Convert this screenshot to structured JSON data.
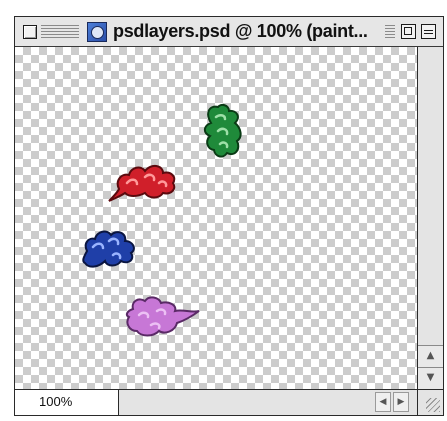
{
  "window": {
    "title": "psdlayers.psd @ 100% (paint...",
    "document_icon": "photoshop-document-icon",
    "controls": [
      "close-box",
      "zoom-box",
      "collapse-box"
    ]
  },
  "canvas": {
    "background": "transparency-checkerboard",
    "layers": [
      {
        "name": "green-paint-splat",
        "color": "#1f8a3a"
      },
      {
        "name": "red-paint-splat",
        "color": "#d01f2a"
      },
      {
        "name": "blue-paint-splat",
        "color": "#1f3fa8"
      },
      {
        "name": "purple-paint-splat",
        "color": "#c777d6"
      }
    ]
  },
  "status_bar": {
    "zoom_value": "100%"
  },
  "scrollbar": {
    "up_icon": "arrow-up-icon",
    "down_icon": "arrow-down-icon",
    "left_icon": "arrow-left-icon",
    "right_icon": "arrow-right-icon"
  }
}
